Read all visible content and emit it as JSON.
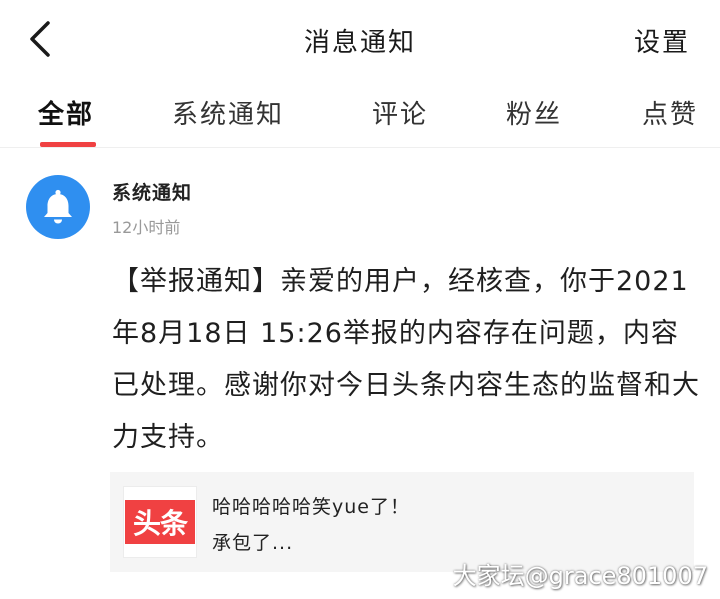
{
  "header": {
    "back_icon": "chevron-left-icon",
    "title": "消息通知",
    "settings_label": "设置"
  },
  "tabs": [
    {
      "label": "全部",
      "active": true
    },
    {
      "label": "系统通知",
      "active": false
    },
    {
      "label": "评论",
      "active": false
    },
    {
      "label": "粉丝",
      "active": false
    },
    {
      "label": "点赞",
      "active": false
    }
  ],
  "message": {
    "avatar_icon": "bell-icon",
    "sender": "系统通知",
    "time": "12小时前",
    "body": "【举报通知】亲爱的用户，经核查，你于2021年8月18日 15:26举报的内容存在问题，内容已处理。感谢你对今日头条内容生态的监督和大力支持。",
    "quote": {
      "logo_text": "头条",
      "line1": "哈哈哈哈哈笑yue了！",
      "line2": "承包了..."
    }
  },
  "watermark": "大家坛@grace801007",
  "colors": {
    "accent": "#f04142",
    "avatar_bg": "#2f8ff0",
    "muted_text": "#999999",
    "card_bg": "#f5f5f5"
  }
}
